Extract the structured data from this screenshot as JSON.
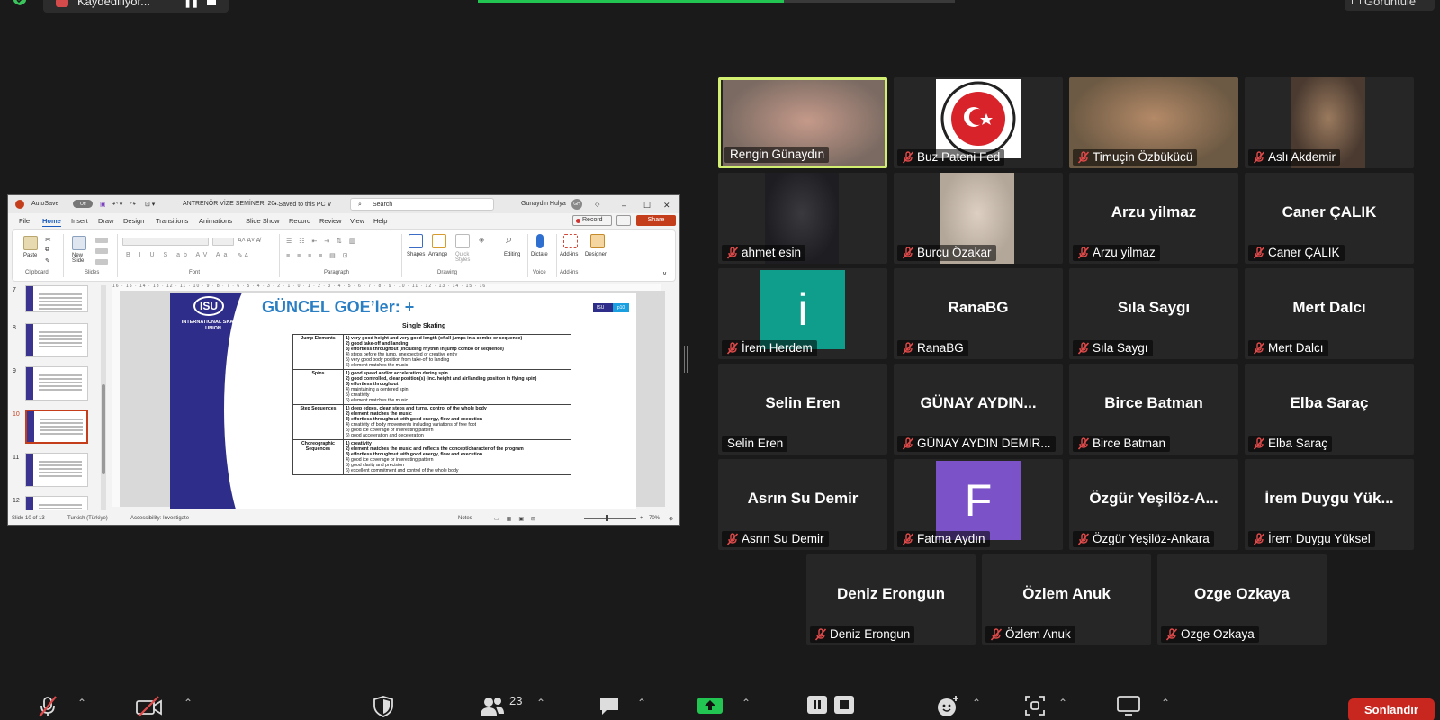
{
  "top": {
    "recording_text": "Kaydediliyor...",
    "view_label": "Görüntüle"
  },
  "ppt": {
    "autosave": "AutoSave",
    "autosave_state": "Off",
    "file_title": "ANTRENÖR VİZE SEMİNERİ 20...",
    "saved": "• Saved to this PC ∨",
    "search_placeholder": "Search",
    "user": "Gunaydin Hulya",
    "user_initials": "GH",
    "menu": [
      "File",
      "Home",
      "Insert",
      "Draw",
      "Design",
      "Transitions",
      "Animations",
      "Slide Show",
      "Record",
      "Review",
      "View",
      "Help"
    ],
    "record_btn": "Record",
    "share_btn": "Share",
    "ribbon": {
      "paste": "Paste",
      "new_slide": "New Slide",
      "shapes": "Shapes",
      "arrange": "Arrange",
      "quick_styles": "Quick Styles",
      "editing": "Editing",
      "dictate": "Dictate",
      "addins": "Add-ins",
      "designer": "Designer",
      "groups": [
        "Clipboard",
        "Slides",
        "Font",
        "Paragraph",
        "Drawing",
        "Voice",
        "Add-ins"
      ]
    },
    "thumb_numbers": [
      "7",
      "8",
      "9",
      "10",
      "11",
      "12"
    ],
    "ruler": "16 · 15 · 14 · 13 · 12 · 11 · 10 · 9 · 8 · 7 · 6 · 5 · 4 · 3 · 2 · 1 · 0 · 1 · 2 · 3 · 4 · 5 · 6 · 7 · 8 · 9 · 10 · 11 · 12 · 13 · 14 · 15 · 16",
    "slide": {
      "logo": "ISU",
      "org": "INTERNATIONAL SKATING UNION",
      "title": "GÜNCEL GOE’ler: +",
      "subtitle": "Single Skating",
      "badge_left": "ISU",
      "badge_right": "p10",
      "rows": [
        {
          "head": "Jump Elements",
          "bold": [
            "1) very good height and very good length (of all jumps in a combo or sequence)",
            "2) good take-off and landing",
            "3) effortless throughout (including rhythm in jump combo or sequence)"
          ],
          "normal": [
            "4) steps before the jump, unexpected or creative entry",
            "5) very good body position from take-off to landing",
            "6) element matches the music"
          ]
        },
        {
          "head": "Spins",
          "bold": [
            "1) good speed and/or acceleration during spin",
            "2) good controlled, clear position(s) (inc. height and air/landing position in flying spin)",
            "3) effortless throughout"
          ],
          "normal": [
            "4) maintaining a centered spin",
            "5) creativity",
            "6) element matches the music"
          ]
        },
        {
          "head": "Step Sequences",
          "bold": [
            "1) deep edges, clean steps and turns, control of the whole body",
            "2) element matches the music",
            "3) effortless throughout with good energy, flow and execution"
          ],
          "normal": [
            "4) creativity of body movements including variations of free foot",
            "5) good ice coverage or interesting pattern",
            "6) good acceleration and deceleration"
          ]
        },
        {
          "head": "Choreographic Sequences",
          "bold": [
            "1) creativity",
            "2) element matches the music and reflects the concept/character of the program",
            "3) effortless throughout with good energy, flow and execution"
          ],
          "normal": [
            "4) good ice coverage or interesting pattern",
            "5) good clarity and precision",
            "6) excellent commitment and control of the whole body"
          ]
        }
      ]
    },
    "status": {
      "slide_of": "Slide 10 of 13",
      "language": "Turkish (Türkiye)",
      "accessibility": "Accessibility: Investigate",
      "notes": "Notes",
      "zoom": "70%"
    }
  },
  "participants": [
    {
      "name": "Rengin Günaydın",
      "type": "video",
      "speaking": true,
      "muted": false
    },
    {
      "name": "Buz Pateni Fed",
      "type": "logo",
      "muted": true
    },
    {
      "name": "Timuçin Özbükücü",
      "type": "video",
      "muted": true
    },
    {
      "name": "Aslı Akdemir",
      "type": "video",
      "muted": true
    },
    {
      "name": "ahmet esin",
      "type": "video",
      "muted": true
    },
    {
      "name": "Burcu Özakar",
      "type": "video",
      "muted": true
    },
    {
      "name": "Arzu yilmaz",
      "center": "Arzu yilmaz",
      "type": "name",
      "muted": true
    },
    {
      "name": "Caner ÇALIK",
      "center": "Caner ÇALIK",
      "type": "name",
      "muted": true
    },
    {
      "name": "İrem Herdem",
      "type": "letter",
      "letter": "i",
      "muted": true
    },
    {
      "name": "RanaBG",
      "center": "RanaBG",
      "type": "name",
      "muted": true
    },
    {
      "name": "Sıla Saygı",
      "center": "Sıla Saygı",
      "type": "name",
      "muted": true
    },
    {
      "name": "Mert Dalcı",
      "center": "Mert Dalcı",
      "type": "name",
      "muted": true
    },
    {
      "name": "Selin Eren",
      "center": "Selin Eren",
      "type": "name",
      "muted": false
    },
    {
      "name": "GÜNAY AYDIN DEMİR...",
      "center": "GÜNAY AYDIN...",
      "type": "name",
      "muted": true
    },
    {
      "name": "Birce Batman",
      "center": "Birce Batman",
      "type": "name",
      "muted": true
    },
    {
      "name": "Elba Saraç",
      "center": "Elba Saraç",
      "type": "name",
      "muted": true
    },
    {
      "name": "Asrın Su Demir",
      "center": "Asrın Su Demir",
      "type": "name",
      "muted": true
    },
    {
      "name": "Fatma Aydın",
      "type": "letter",
      "letter": "F",
      "muted": true
    },
    {
      "name": "Özgür Yeşilöz-Ankara",
      "center": "Özgür  Yeşilöz-A...",
      "type": "name",
      "muted": true
    },
    {
      "name": "İrem Duygu Yüksel",
      "center": "İrem  Duygu  Yük...",
      "type": "name",
      "muted": true
    },
    {
      "name": "Deniz Erongun",
      "center": "Deniz Erongun",
      "type": "name",
      "muted": true
    },
    {
      "name": "Özlem Anuk",
      "center": "Özlem Anuk",
      "type": "name",
      "muted": true
    },
    {
      "name": "Ozge Ozkaya",
      "center": "Ozge Ozkaya",
      "type": "name",
      "muted": true
    }
  ],
  "toolbar": {
    "participant_count": "23",
    "end_label": "Sonlandır"
  },
  "colors": {
    "speaker_border": "#d3ef72",
    "share_green": "#23c552",
    "muted_red": "#e04a4a",
    "end_red": "#c8271f",
    "avatar_teal": "#0f9d8c",
    "avatar_purple": "#7b52c7"
  }
}
